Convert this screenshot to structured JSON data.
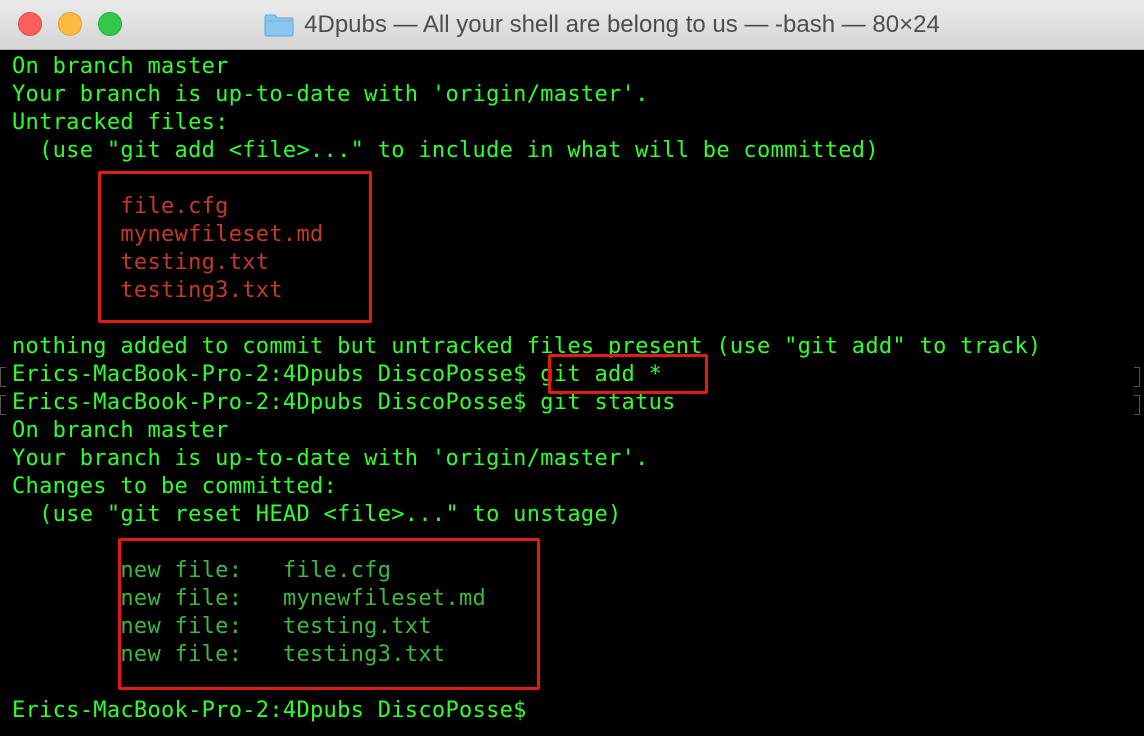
{
  "window": {
    "title": "4Dpubs — All your shell are belong to us — -bash — 80×24",
    "controls": [
      "close",
      "minimize",
      "zoom"
    ],
    "title_icon": "folder-icon"
  },
  "terminal": {
    "lines": [
      "On branch master",
      "Your branch is up-to-date with 'origin/master'.",
      "Untracked files:",
      "  (use \"git add <file>...\" to include in what will be committed)",
      "",
      "        file.cfg",
      "        mynewfileset.md",
      "        testing.txt",
      "        testing3.txt",
      "",
      "nothing added to commit but untracked files present (use \"git add\" to track)",
      "Erics-MacBook-Pro-2:4Dpubs DiscoPosse$ git add *",
      "Erics-MacBook-Pro-2:4Dpubs DiscoPosse$ git status",
      "On branch master",
      "Your branch is up-to-date with 'origin/master'.",
      "Changes to be committed:",
      "  (use \"git reset HEAD <file>...\" to unstage)",
      "",
      "        new file:   file.cfg",
      "        new file:   mynewfileset.md",
      "        new file:   testing.txt",
      "        new file:   testing3.txt",
      "",
      "Erics-MacBook-Pro-2:4Dpubs DiscoPosse$ "
    ]
  },
  "colors": {
    "foreground": "#2fff2f",
    "untracked": "#c23b2a",
    "staged": "#3fb83f",
    "highlight_box": "#e01b12",
    "background": "#000000"
  }
}
